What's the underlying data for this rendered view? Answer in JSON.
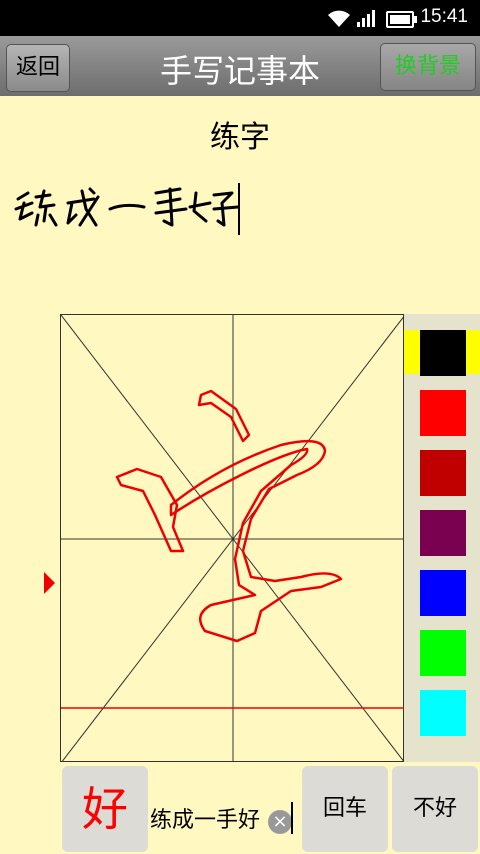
{
  "status_bar": {
    "time": "15:41"
  },
  "title_bar": {
    "back_label": "返回",
    "title": "手写记事本",
    "change_bg_label": "换背景"
  },
  "note": {
    "heading": "练字",
    "handwritten_text": "练成一手好"
  },
  "palette": {
    "colors": [
      "#000000",
      "#ff0000",
      "#c00000",
      "#7a0050",
      "#0000ff",
      "#00ff00",
      "#00ffff"
    ],
    "selected_index": 0
  },
  "bottom_bar": {
    "candidate": "好",
    "input_text": "练成一手好",
    "enter_label": "回车",
    "not_good_label": "不好"
  }
}
